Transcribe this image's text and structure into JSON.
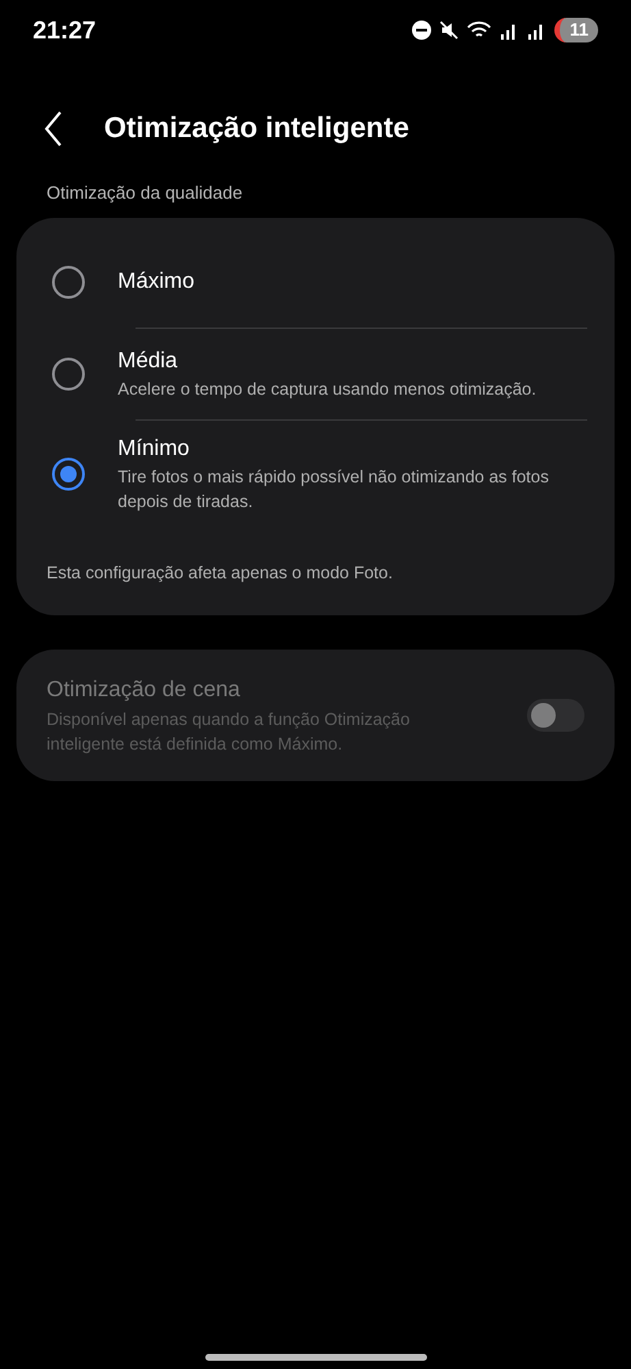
{
  "status_bar": {
    "time": "21:27",
    "battery": "11"
  },
  "header": {
    "title": "Otimização inteligente"
  },
  "quality": {
    "label": "Otimização da qualidade",
    "options": [
      {
        "title": "Máximo",
        "selected": false
      },
      {
        "title": "Média",
        "description": "Acelere o tempo de captura usando menos otimização.",
        "selected": false
      },
      {
        "title": "Mínimo",
        "description": "Tire fotos o mais rápido possível não otimizando as fotos depois de tiradas.",
        "selected": true
      }
    ],
    "note": "Esta configuração afeta apenas o modo Foto."
  },
  "scene": {
    "title": "Otimização de cena",
    "description": "Disponível apenas quando a função Otimização inteligente está definida como Máximo.",
    "disabled": true,
    "on": false
  }
}
